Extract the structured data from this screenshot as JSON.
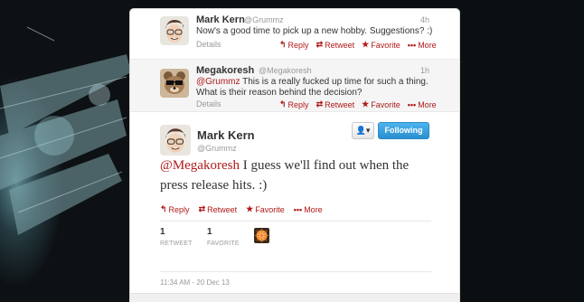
{
  "tweets": [
    {
      "name": "Mark Kern",
      "handle": "@Grummz",
      "time": "4h",
      "text": "Now's a good time to pick up a new hobby. Suggestions? :)",
      "details": "Details",
      "actions": {
        "reply": "Reply",
        "retweet": "Retweet",
        "favorite": "Favorite",
        "more": "More"
      }
    },
    {
      "name": "Megakoresh",
      "handle": "@Megakoresh",
      "time": "1h",
      "mention": "@Grummz",
      "text": " This is a really fucked up time for such a thing. What is their reason behind the decision?",
      "details": "Details",
      "actions": {
        "reply": "Reply",
        "retweet": "Retweet",
        "favorite": "Favorite",
        "more": "More"
      }
    }
  ],
  "expanded": {
    "name": "Mark Kern",
    "handle": "@Grummz",
    "user_button": "▾",
    "follow_button": "Following",
    "mention": "@Megakoresh",
    "text": " I guess we'll find out when the press release hits. :)",
    "actions": {
      "reply": "Reply",
      "retweet": "Retweet",
      "favorite": "Favorite",
      "more": "More"
    },
    "retweets": {
      "count": "1",
      "label": "RETWEET"
    },
    "favorites": {
      "count": "1",
      "label": "FAVORITE"
    },
    "timestamp": "11:34 AM - 20 Dec 13"
  },
  "icons": {
    "reply": "reply-arrow-icon",
    "retweet": "retweet-icon",
    "favorite": "star-icon",
    "more": "dots-icon",
    "user": "user-icon"
  },
  "colors": {
    "accent": "#b01a1a",
    "follow_button": "#2a8fcf"
  }
}
